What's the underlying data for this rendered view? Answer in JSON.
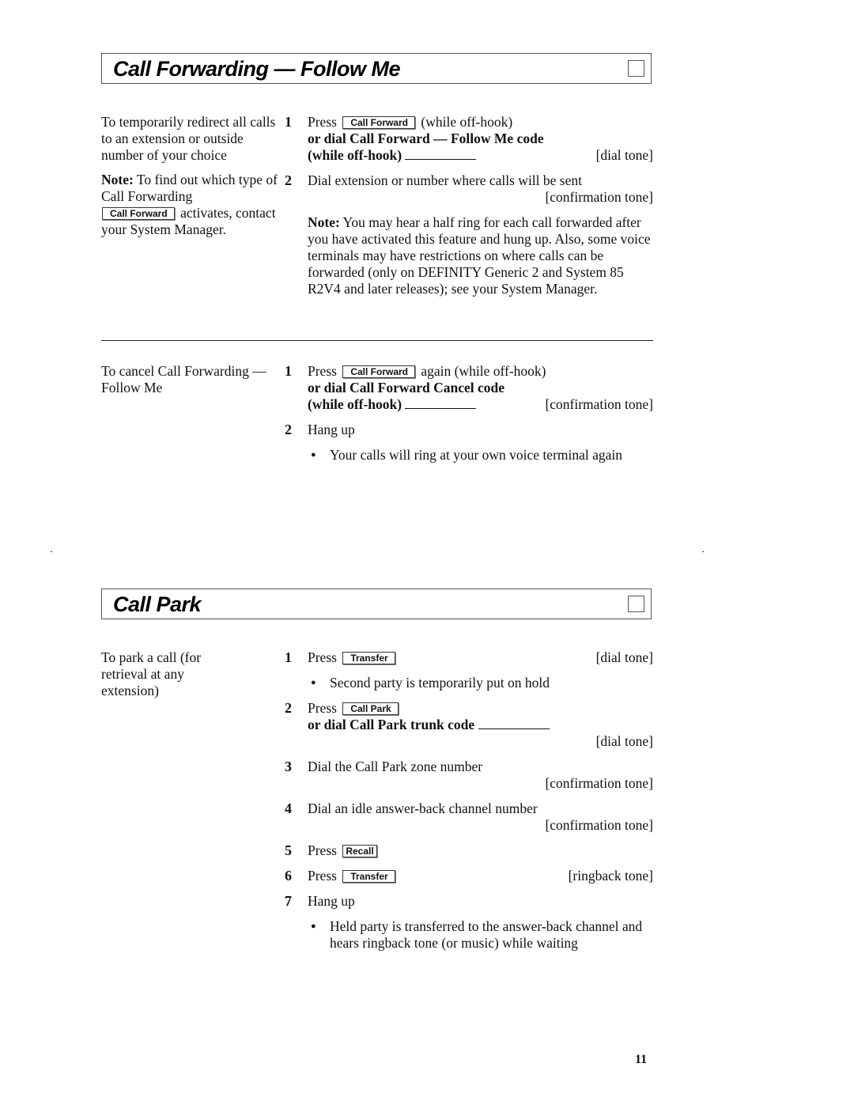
{
  "sections": [
    {
      "title": "Call Forwarding — Follow Me",
      "blocks": [
        {
          "description": "To temporarily redirect all calls to an extension or outside number of your choice",
          "note_label": "Note:",
          "note_pre": "To find out which type of Call Forwarding",
          "note_key": "Call Forward",
          "note_post": "activates, contact your System Manager.",
          "steps": [
            {
              "num": "1",
              "press": "Press",
              "key": "Call Forward",
              "after": "(while off-hook)",
              "bold_line1": "or dial Call Forward — Follow Me code",
              "bold_line2": "(while off-hook)",
              "tone": "[dial tone]"
            },
            {
              "num": "2",
              "text": "Dial extension or number where calls will be sent",
              "tone": "[confirmation tone]",
              "note_label": "Note:",
              "note_text": "You may hear a half ring for each call forwarded after you have activated this feature and hung up.  Also, some voice terminals may have restrictions on where calls can be forwarded (only on DEFINITY Generic 2 and System 85 R2V4 and later releases); see your System Manager."
            }
          ]
        },
        {
          "description": "To cancel Call Forwarding — Follow Me",
          "steps": [
            {
              "num": "1",
              "press": "Press",
              "key": "Call Forward",
              "after": "again (while off-hook)",
              "bold_line1": "or dial Call Forward Cancel code",
              "bold_line2": "(while off-hook)",
              "tone": "[confirmation tone]"
            },
            {
              "num": "2",
              "text": "Hang up",
              "bullet": "Your calls will ring at your own voice terminal again"
            }
          ]
        }
      ]
    },
    {
      "title": "Call Park",
      "blocks": [
        {
          "description": "To park a call (for retrieval at any extension)",
          "steps": [
            {
              "num": "1",
              "press": "Press",
              "key": "Transfer",
              "tone": "[dial tone]",
              "bullet": "Second party is temporarily put on hold"
            },
            {
              "num": "2",
              "press": "Press",
              "key": "Call Park",
              "bold_line1": "or dial Call Park trunk code",
              "tone": "[dial tone]"
            },
            {
              "num": "3",
              "text": "Dial the Call Park zone number",
              "tone": "[confirmation tone]"
            },
            {
              "num": "4",
              "text": "Dial an idle answer-back channel number",
              "tone": "[confirmation tone]"
            },
            {
              "num": "5",
              "press": "Press",
              "key": "Recall"
            },
            {
              "num": "6",
              "press": "Press",
              "key": "Transfer",
              "tone": "[ringback tone]"
            },
            {
              "num": "7",
              "text": "Hang up",
              "bullet": "Held party is transferred to the answer-back channel and hears ringback tone (or music) while waiting"
            }
          ]
        }
      ]
    }
  ],
  "page_number": "11"
}
